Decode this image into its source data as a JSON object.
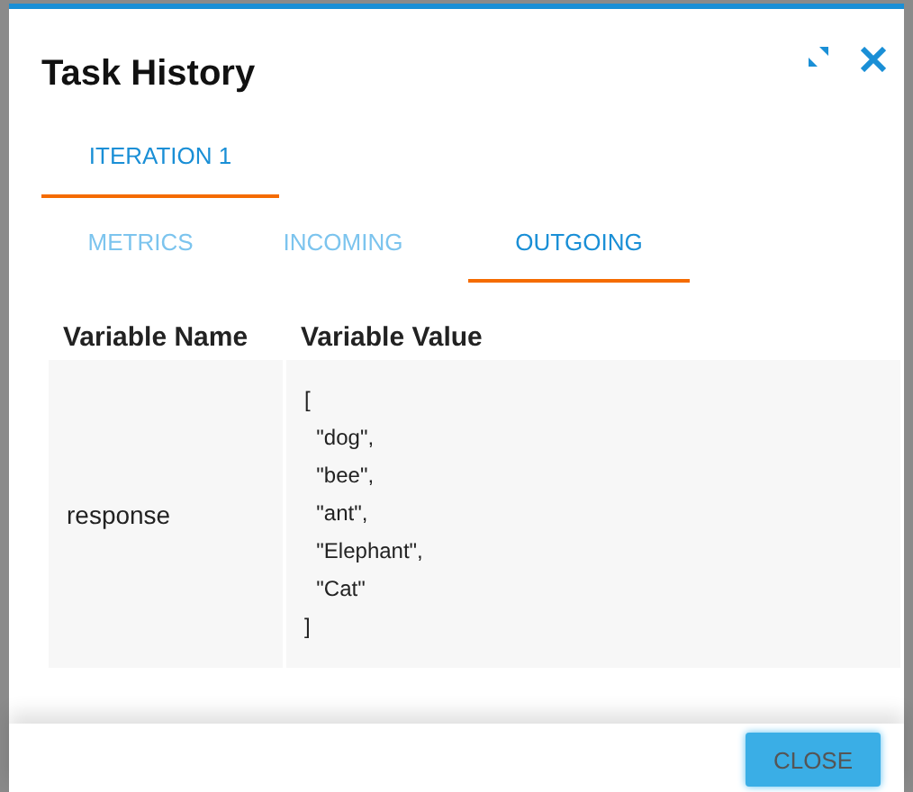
{
  "dialog": {
    "title": "Task History"
  },
  "iteration_tabs": [
    {
      "label": "ITERATION 1",
      "selected": true
    }
  ],
  "section_tabs": [
    {
      "label": "METRICS",
      "selected": false
    },
    {
      "label": "INCOMING",
      "selected": false
    },
    {
      "label": "OUTGOING",
      "selected": true
    }
  ],
  "table": {
    "columns": [
      "Variable Name",
      "Variable Value"
    ],
    "rows": [
      {
        "name": "response",
        "value": "[\n  \"dog\",\n  \"bee\",\n  \"ant\",\n  \"Elephant\",\n  \"Cat\"\n]"
      }
    ]
  },
  "buttons": [
    "CLOSE"
  ]
}
